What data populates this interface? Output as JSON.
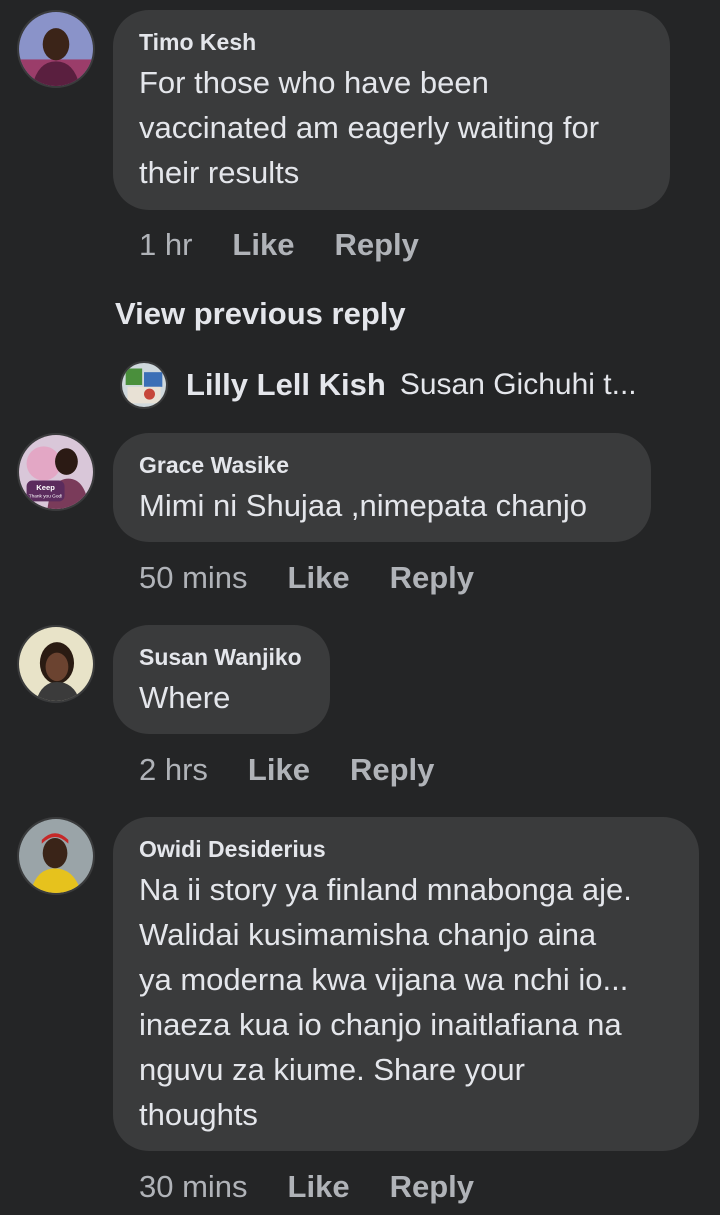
{
  "comments": [
    {
      "author": "Timo Kesh",
      "lines": [
        "For those who have been",
        "vaccinated am eagerly waiting for",
        "their results"
      ],
      "time": "1 hr",
      "like": "Like",
      "reply": "Reply"
    },
    {
      "author": "Grace Wasike",
      "lines": [
        "Mimi ni Shujaa ,nimepata chanjo"
      ],
      "time": "50 mins",
      "like": "Like",
      "reply": "Reply"
    },
    {
      "author": "Susan Wanjiko",
      "lines": [
        "Where"
      ],
      "time": "2 hrs",
      "like": "Like",
      "reply": "Reply"
    },
    {
      "author": "Owidi Desiderius",
      "lines": [
        "Na ii story ya finland mnabonga aje.",
        "Walidai kusimamisha chanjo aina",
        "ya moderna kwa vijana wa nchi io...",
        "inaeza kua io chanjo inaitlafiana na",
        "nguvu za kiume. Share your",
        "thoughts"
      ],
      "time": "30 mins",
      "like": "Like",
      "reply": "Reply"
    }
  ],
  "thread": {
    "view_previous": "View previous reply",
    "reply_author": "Lilly Lell Kish",
    "reply_snippet": "Susan Gichuhi t..."
  },
  "avatar_badge_text": [
    "Keep",
    "Thank you God!"
  ],
  "colors": {
    "background": "#242526",
    "bubble": "#3a3b3c",
    "primary_text": "#e4e6eb",
    "secondary_text": "#b0b3b8"
  }
}
